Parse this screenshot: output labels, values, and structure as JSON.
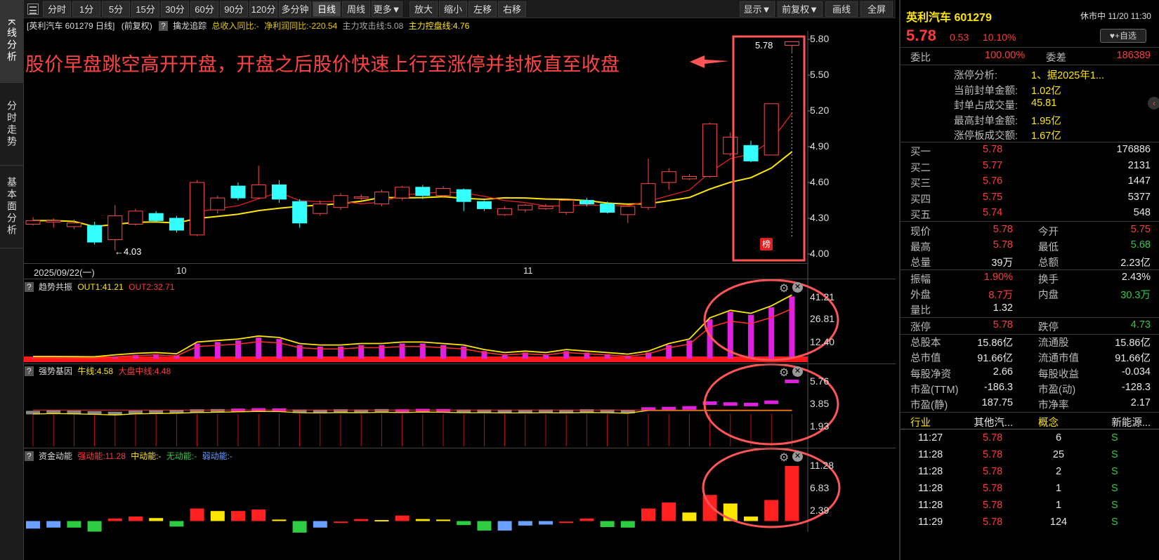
{
  "nav": {
    "tabs": [
      "K线分析",
      "分时走势",
      "基本面分析"
    ]
  },
  "toolbar": {
    "items": [
      "分时",
      "1分",
      "5分",
      "15分",
      "30分",
      "60分",
      "90分",
      "120分",
      "多分钟",
      "日线",
      "周线",
      "更多▼",
      "放大",
      "缩小",
      "左移",
      "右移"
    ],
    "right": [
      "显示▼",
      "前复权▼",
      "画线",
      "全屏"
    ]
  },
  "chart_info": {
    "title": "[英利汽车 601279 日线]",
    "fq": "(前复权)",
    "q": "?",
    "indicator": "擒龙追踪",
    "income": "总收入同比:-",
    "profit": "净利润同比:-220.54",
    "attack": "主力攻击线:5.08",
    "control": "主力控盘线:4.76"
  },
  "annotation": {
    "text": "股价早盘跳空高开开盘，开盘之后股价快速上行至涨停并封板直至收盘"
  },
  "price_axis": [
    "5.80",
    "5.50",
    "5.20",
    "4.90",
    "4.60",
    "4.30",
    "4.00"
  ],
  "price_marks": {
    "high": "5.78",
    "low": "4.03",
    "badge": "榜"
  },
  "date_axis": {
    "start": "2025/09/22(一)",
    "m10": "10",
    "m11": "11"
  },
  "panel1": {
    "q": "?",
    "name": "趋势共振",
    "out1": "OUT1:41.21",
    "out2": "OUT2:32.71",
    "axis": [
      "41.21",
      "26.81",
      "12.40"
    ]
  },
  "panel2": {
    "q": "?",
    "name": "强势基因",
    "bull": "牛线:4.58",
    "market": "大盘中线:4.48",
    "axis": [
      "5.76",
      "3.85",
      "1.93"
    ]
  },
  "panel3": {
    "q": "?",
    "name": "资金动能",
    "strong": "强动能:11.28",
    "mid": "中动能:-",
    "none": "无动能:-",
    "weak": "弱动能:-",
    "axis": [
      "11.28",
      "6.83",
      "2.39"
    ]
  },
  "quote": {
    "name": "英利汽车 601279",
    "status": "休市中 11/20 11:30",
    "price": "5.78",
    "chg": "0.53",
    "pct": "10.10%",
    "fav": "♥+自选",
    "wb_label": "委比",
    "wb": "100.00%",
    "wc_label": "委差",
    "wc": "186389",
    "limit": [
      {
        "label": "涨停分析:",
        "value": "1、据2025年1..."
      },
      {
        "label": "当前封单金额:",
        "value": "1.02亿"
      },
      {
        "label": "封单占成交量:",
        "value": "45.81"
      },
      {
        "label": "最高封单金额:",
        "value": "1.95亿"
      },
      {
        "label": "涨停板成交额:",
        "value": "1.67亿"
      }
    ],
    "bids": [
      {
        "label": "买一",
        "price": "5.78",
        "vol": "176886"
      },
      {
        "label": "买二",
        "price": "5.77",
        "vol": "2131"
      },
      {
        "label": "买三",
        "price": "5.76",
        "vol": "1447"
      },
      {
        "label": "买四",
        "price": "5.75",
        "vol": "5377"
      },
      {
        "label": "买五",
        "price": "5.74",
        "vol": "548"
      }
    ],
    "stats": [
      [
        "现价",
        "5.78",
        "今开",
        "5.75"
      ],
      [
        "最高",
        "5.78",
        "最低",
        "5.68"
      ],
      [
        "总量",
        "39万",
        "总额",
        "2.23亿"
      ],
      [
        "振幅",
        "1.90%",
        "换手",
        "2.43%"
      ],
      [
        "外盘",
        "8.7万",
        "内盘",
        "30.3万"
      ],
      [
        "量比",
        "1.32",
        "",
        ""
      ],
      [
        "涨停",
        "5.78",
        "跌停",
        "4.73"
      ],
      [
        "总股本",
        "15.86亿",
        "流通股",
        "15.86亿"
      ],
      [
        "总市值",
        "91.66亿",
        "流通市值",
        "91.66亿"
      ],
      [
        "每股净资",
        "2.66",
        "每股收益",
        "-0.034"
      ],
      [
        "市盈(TTM)",
        "-186.3",
        "市盈(动)",
        "-128.3"
      ],
      [
        "市盈(静)",
        "187.75",
        "市净率",
        "2.17"
      ],
      [
        "行业",
        "其他汽...",
        "概念",
        "新能源..."
      ]
    ],
    "ticks": [
      [
        "11:27",
        "5.78",
        "6",
        "S"
      ],
      [
        "11:28",
        "5.78",
        "25",
        "S"
      ],
      [
        "11:28",
        "5.78",
        "2",
        "S"
      ],
      [
        "11:28",
        "5.78",
        "1",
        "S"
      ],
      [
        "11:28",
        "5.78",
        "1",
        "S"
      ],
      [
        "11:29",
        "5.78",
        "124",
        "S"
      ]
    ]
  },
  "chart_data": {
    "type": "candlestick",
    "x_labels": [
      "2025/09/22(一)",
      "10",
      "11"
    ],
    "ylim": [
      4.0,
      5.9
    ],
    "candles": [
      {
        "o": 4.25,
        "c": 4.28,
        "h": 4.31,
        "l": 4.24
      },
      {
        "o": 4.27,
        "c": 4.28,
        "h": 4.3,
        "l": 4.22
      },
      {
        "o": 4.23,
        "c": 4.26,
        "h": 4.29,
        "l": 4.21
      },
      {
        "o": 4.24,
        "c": 4.1,
        "h": 4.27,
        "l": 4.08
      },
      {
        "o": 4.12,
        "c": 4.32,
        "h": 4.41,
        "l": 4.03
      },
      {
        "o": 4.25,
        "c": 4.36,
        "h": 4.38,
        "l": 4.24
      },
      {
        "o": 4.34,
        "c": 4.28,
        "h": 4.36,
        "l": 4.27
      },
      {
        "o": 4.3,
        "c": 4.2,
        "h": 4.32,
        "l": 4.18
      },
      {
        "o": 4.16,
        "c": 4.6,
        "h": 4.62,
        "l": 4.15
      },
      {
        "o": 4.37,
        "c": 4.47,
        "h": 4.49,
        "l": 4.34
      },
      {
        "o": 4.57,
        "c": 4.47,
        "h": 4.6,
        "l": 4.45
      },
      {
        "o": 4.47,
        "c": 4.58,
        "h": 4.74,
        "l": 4.46
      },
      {
        "o": 4.58,
        "c": 4.46,
        "h": 4.62,
        "l": 4.43
      },
      {
        "o": 4.44,
        "c": 4.26,
        "h": 4.46,
        "l": 4.22
      },
      {
        "o": 4.34,
        "c": 4.42,
        "h": 4.45,
        "l": 4.32
      },
      {
        "o": 4.39,
        "c": 4.49,
        "h": 4.51,
        "l": 4.37
      },
      {
        "o": 4.47,
        "c": 4.48,
        "h": 4.5,
        "l": 4.45
      },
      {
        "o": 4.42,
        "c": 4.52,
        "h": 4.54,
        "l": 4.4
      },
      {
        "o": 4.47,
        "c": 4.56,
        "h": 4.57,
        "l": 4.45
      },
      {
        "o": 4.56,
        "c": 4.49,
        "h": 4.58,
        "l": 4.46
      },
      {
        "o": 4.49,
        "c": 4.55,
        "h": 4.57,
        "l": 4.47
      },
      {
        "o": 4.54,
        "c": 4.44,
        "h": 4.55,
        "l": 4.36
      },
      {
        "o": 4.44,
        "c": 4.38,
        "h": 4.45,
        "l": 4.36
      },
      {
        "o": 4.33,
        "c": 4.38,
        "h": 4.4,
        "l": 4.32
      },
      {
        "o": 4.37,
        "c": 4.41,
        "h": 4.42,
        "l": 4.35
      },
      {
        "o": 4.38,
        "c": 4.4,
        "h": 4.42,
        "l": 4.37
      },
      {
        "o": 4.35,
        "c": 4.45,
        "h": 4.46,
        "l": 4.33
      },
      {
        "o": 4.45,
        "c": 4.42,
        "h": 4.47,
        "l": 4.4
      },
      {
        "o": 4.42,
        "c": 4.35,
        "h": 4.44,
        "l": 4.34
      },
      {
        "o": 4.33,
        "c": 4.4,
        "h": 4.41,
        "l": 4.26
      },
      {
        "o": 4.39,
        "c": 4.59,
        "h": 4.8,
        "l": 4.37
      },
      {
        "o": 4.6,
        "c": 4.69,
        "h": 4.72,
        "l": 4.54
      },
      {
        "o": 4.63,
        "c": 4.65,
        "h": 4.67,
        "l": 4.62
      },
      {
        "o": 4.65,
        "c": 5.09,
        "h": 5.1,
        "l": 4.64
      },
      {
        "o": 4.84,
        "c": 4.98,
        "h": 5.02,
        "l": 4.82
      },
      {
        "o": 4.91,
        "c": 4.78,
        "h": 4.95,
        "l": 4.77
      },
      {
        "o": 4.83,
        "c": 5.26,
        "h": 5.26,
        "l": 4.83
      },
      {
        "o": 5.75,
        "c": 5.78,
        "h": 5.78,
        "l": 5.68
      }
    ]
  }
}
